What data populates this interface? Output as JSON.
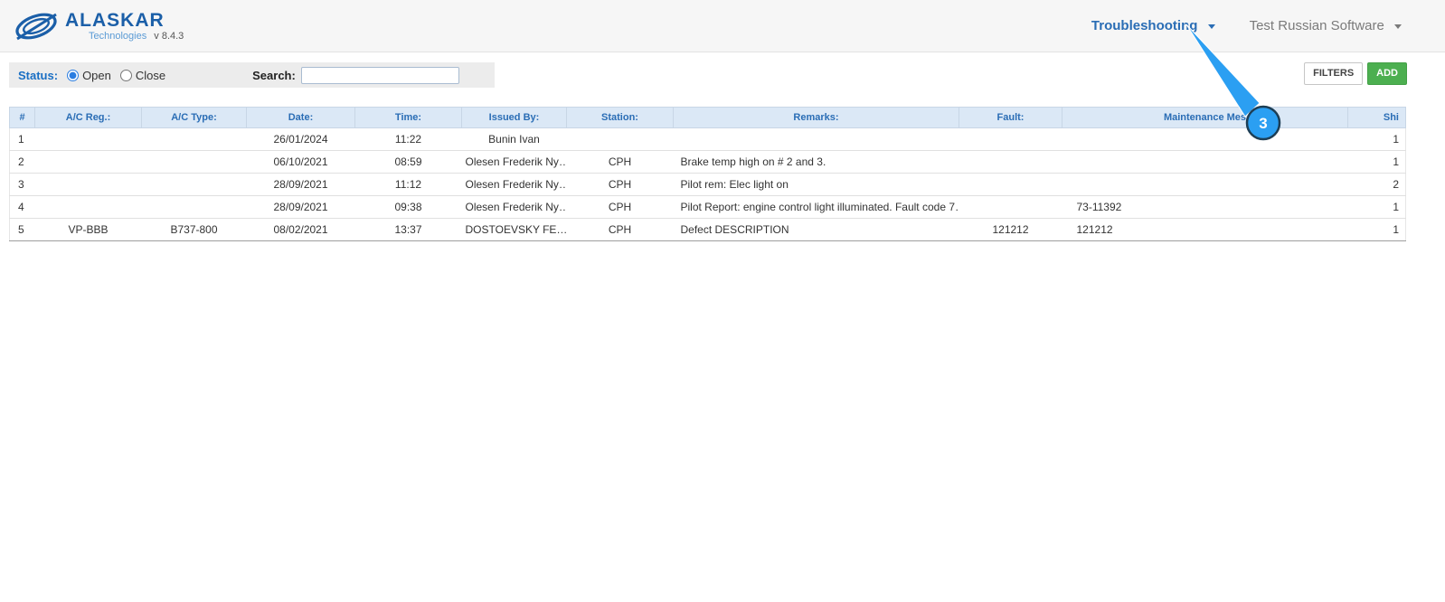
{
  "header": {
    "brand": "ALASKAR",
    "brand_sub": "Technologies",
    "version": "v 8.4.3",
    "nav": [
      {
        "label": "Troubleshooting"
      },
      {
        "label": "Test Russian Software"
      }
    ]
  },
  "toolbar": {
    "status_label": "Status:",
    "status_options": [
      {
        "label": "Open",
        "selected": true
      },
      {
        "label": "Close",
        "selected": false
      }
    ],
    "search_label": "Search:",
    "search_value": "",
    "filters_button": "FILTERS",
    "add_button": "ADD"
  },
  "table": {
    "columns": [
      "#",
      "A/C Reg.:",
      "A/C Type:",
      "Date:",
      "Time:",
      "Issued By:",
      "Station:",
      "Remarks:",
      "Fault:",
      "Maintenance Mes",
      "Shi"
    ],
    "rows": [
      [
        "1",
        "",
        "",
        "26/01/2024",
        "11:22",
        "Bunin Ivan",
        "",
        "",
        "",
        "",
        "1"
      ],
      [
        "2",
        "",
        "",
        "06/10/2021",
        "08:59",
        "Olesen Frederik Ny…",
        "CPH",
        "Brake temp high on # 2 and 3.",
        "",
        "",
        "1"
      ],
      [
        "3",
        "",
        "",
        "28/09/2021",
        "11:12",
        "Olesen Frederik Ny…",
        "CPH",
        "Pilot rem: Elec light on",
        "",
        "",
        "2"
      ],
      [
        "4",
        "",
        "",
        "28/09/2021",
        "09:38",
        "Olesen Frederik Ny…",
        "CPH",
        "Pilot Report: engine control light illuminated. Fault code 7…",
        "",
        "73-11392",
        "1"
      ],
      [
        "5",
        "VP-BBB",
        "B737-800",
        "08/02/2021",
        "13:37",
        "DOSTOEVSKY FE…",
        "CPH",
        "Defect DESCRIPTION",
        "121212",
        "121212",
        "1"
      ]
    ]
  },
  "annotation": {
    "step": "3"
  },
  "colors": {
    "accent_blue": "#2a6db5",
    "logo_blue": "#1b5fa8",
    "add_green": "#4caf50",
    "annotation_blue": "#2b9ff2",
    "table_header_bg": "#dbe8f6"
  }
}
